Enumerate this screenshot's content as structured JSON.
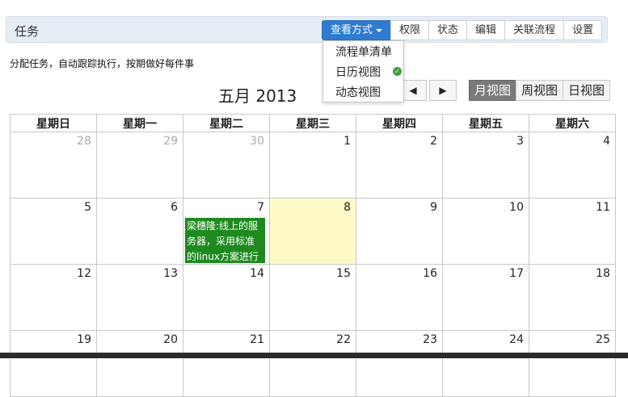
{
  "header": {
    "title": "任务",
    "buttons": [
      "查看方式",
      "权限",
      "状态",
      "编辑",
      "关联流程",
      "设置"
    ]
  },
  "subtitle": "分配任务，自动跟踪执行，按期做好每件事",
  "view_menu": {
    "items": [
      "流程单清单",
      "日历视图",
      "动态视图"
    ],
    "selected_index": 1
  },
  "calendar": {
    "title": "五月 2013",
    "prev_icon": "◀",
    "next_icon": "▶",
    "view_buttons": [
      "月视图",
      "周视图",
      "日视图"
    ],
    "active_view": "月视图",
    "weekdays": [
      "星期日",
      "星期一",
      "星期二",
      "星期三",
      "星期四",
      "星期五",
      "星期六"
    ],
    "weeks": [
      [
        "28",
        "29",
        "30",
        "1",
        "2",
        "3",
        "4"
      ],
      [
        "5",
        "6",
        "7",
        "8",
        "9",
        "10",
        "11"
      ],
      [
        "12",
        "13",
        "14",
        "15",
        "16",
        "17",
        "18"
      ],
      [
        "19",
        "20",
        "21",
        "22",
        "23",
        "24",
        "25"
      ]
    ],
    "today": "8",
    "event": {
      "date": "7",
      "text": "梁穗隆:线上的服务器，采用标准的linux方案进行安装",
      "color": "#1e8a1e"
    }
  },
  "colors": {
    "primary": "#2f7bd1",
    "today_bg": "#fdfac8",
    "active_view_bg": "#7a7a7a"
  }
}
